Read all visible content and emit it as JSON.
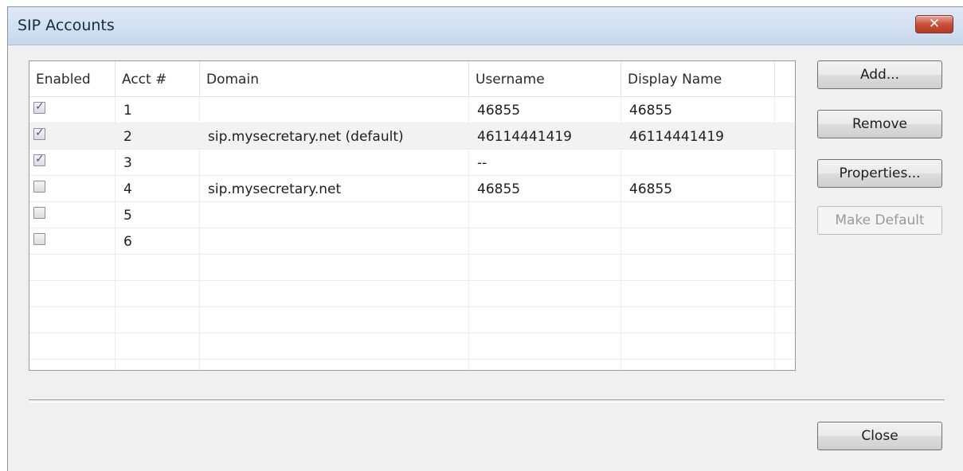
{
  "window": {
    "title": "SIP Accounts",
    "close_glyph": "✕"
  },
  "table": {
    "columns": [
      "Enabled",
      "Acct #",
      "Domain",
      "Username",
      "Display Name"
    ],
    "rows": [
      {
        "enabled": true,
        "acct": "1",
        "domain": "",
        "username": "46855",
        "display_name": "46855"
      },
      {
        "enabled": true,
        "acct": "2",
        "domain": "sip.mysecretary.net (default)",
        "username": "46114441419",
        "display_name": "46114441419"
      },
      {
        "enabled": true,
        "acct": "3",
        "domain": "",
        "username": "--",
        "display_name": ""
      },
      {
        "enabled": false,
        "acct": "4",
        "domain": "sip.mysecretary.net",
        "username": "46855",
        "display_name": "46855"
      },
      {
        "enabled": false,
        "acct": "5",
        "domain": "",
        "username": "",
        "display_name": ""
      },
      {
        "enabled": false,
        "acct": "6",
        "domain": "",
        "username": "",
        "display_name": ""
      }
    ],
    "check_glyph": "✓"
  },
  "buttons": {
    "add": "Add...",
    "remove": "Remove",
    "properties": "Properties...",
    "make_default": "Make Default",
    "close": "Close"
  }
}
